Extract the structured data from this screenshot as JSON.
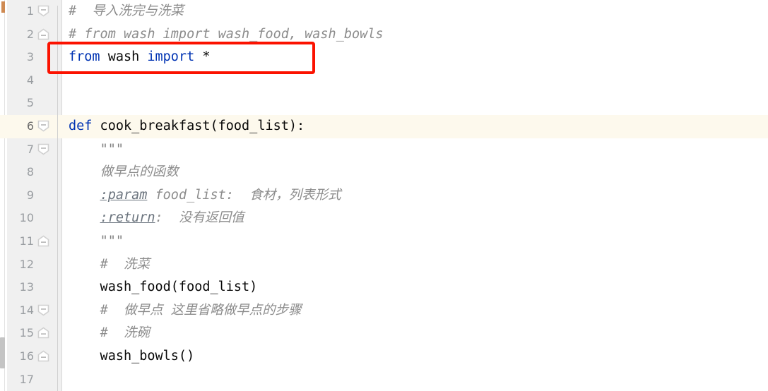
{
  "editor": {
    "language": "Python",
    "current_line": 6,
    "total_lines_visible": 17,
    "colors": {
      "keyword": "#0033b3",
      "comment": "#8c8c8c",
      "text": "#080808",
      "gutter_bg": "#f0f0f0",
      "line_number": "#999da1",
      "current_line_bg": "#fdf9ed",
      "annotation_red": "#fb1200"
    }
  },
  "annotation": {
    "name": "red-highlight-box",
    "target_line": 3,
    "target_text": "from wash import *"
  },
  "gutter": {
    "line_numbers": [
      "1",
      "2",
      "3",
      "4",
      "5",
      "6",
      "7",
      "8",
      "9",
      "10",
      "11",
      "12",
      "13",
      "14",
      "15",
      "16",
      "17"
    ]
  },
  "lines": [
    {
      "number": "1",
      "fold": "start",
      "plain": "# 导入洗完与洗菜",
      "tokens": [
        {
          "t": "# ",
          "c": "comment"
        },
        {
          "t": " 导入洗完与洗菜",
          "c": "comment"
        }
      ]
    },
    {
      "number": "2",
      "fold": "end",
      "plain": "# from wash import wash_food, wash_bowls",
      "tokens": [
        {
          "t": "# from wash import wash_food, wash_bowls",
          "c": "comment"
        }
      ]
    },
    {
      "number": "3",
      "fold": "none",
      "plain": "from wash import *",
      "tokens": [
        {
          "t": "from",
          "c": "kw"
        },
        {
          "t": " wash ",
          "c": "plain"
        },
        {
          "t": "import",
          "c": "kw"
        },
        {
          "t": " *",
          "c": "plain"
        }
      ]
    },
    {
      "number": "4",
      "fold": "none",
      "plain": "",
      "tokens": []
    },
    {
      "number": "5",
      "fold": "none",
      "plain": "",
      "tokens": []
    },
    {
      "number": "6",
      "fold": "start",
      "plain": "def cook_breakfast(food_list):",
      "tokens": [
        {
          "t": "def",
          "c": "kw"
        },
        {
          "t": " cook_breakfast(food_list):",
          "c": "plain"
        }
      ]
    },
    {
      "number": "7",
      "fold": "start",
      "plain": "    \"\"\"",
      "tokens": [
        {
          "t": "    ",
          "c": "plain"
        },
        {
          "t": "\"\"\"",
          "c": "quotes"
        }
      ]
    },
    {
      "number": "8",
      "fold": "none",
      "plain": "    做早点的函数",
      "tokens": [
        {
          "t": "    ",
          "c": "plain"
        },
        {
          "t": "做早点的函数",
          "c": "docstr"
        }
      ]
    },
    {
      "number": "9",
      "fold": "none",
      "plain": "    :param food_list: 食材，列表形式",
      "tokens": [
        {
          "t": "    ",
          "c": "plain"
        },
        {
          "t": ":param",
          "c": "doctag"
        },
        {
          "t": " food_list:  食材，列表形式",
          "c": "docstr"
        }
      ]
    },
    {
      "number": "10",
      "fold": "none",
      "plain": "    :return: 没有返回值",
      "tokens": [
        {
          "t": "    ",
          "c": "plain"
        },
        {
          "t": ":return",
          "c": "doctag"
        },
        {
          "t": ":  没有返回值",
          "c": "docstr"
        }
      ]
    },
    {
      "number": "11",
      "fold": "end",
      "plain": "    \"\"\"",
      "tokens": [
        {
          "t": "    ",
          "c": "plain"
        },
        {
          "t": "\"\"\"",
          "c": "quotes"
        }
      ]
    },
    {
      "number": "12",
      "fold": "none",
      "plain": "    # 洗菜",
      "tokens": [
        {
          "t": "    ",
          "c": "plain"
        },
        {
          "t": "#  洗菜",
          "c": "comment"
        }
      ]
    },
    {
      "number": "13",
      "fold": "none",
      "plain": "    wash_food(food_list)",
      "tokens": [
        {
          "t": "    wash_food(food_list)",
          "c": "plain"
        }
      ]
    },
    {
      "number": "14",
      "fold": "start",
      "plain": "    # 做早点 这里省略做早点的步骤",
      "tokens": [
        {
          "t": "    ",
          "c": "plain"
        },
        {
          "t": "#  做早点 这里省略做早点的步骤",
          "c": "comment"
        }
      ]
    },
    {
      "number": "15",
      "fold": "end",
      "plain": "    # 洗碗",
      "tokens": [
        {
          "t": "    ",
          "c": "plain"
        },
        {
          "t": "#  洗碗",
          "c": "comment"
        }
      ]
    },
    {
      "number": "16",
      "fold": "end",
      "plain": "    wash_bowls()",
      "tokens": [
        {
          "t": "    wash_bowls()",
          "c": "plain"
        }
      ]
    },
    {
      "number": "17",
      "fold": "none",
      "plain": "",
      "tokens": []
    }
  ]
}
